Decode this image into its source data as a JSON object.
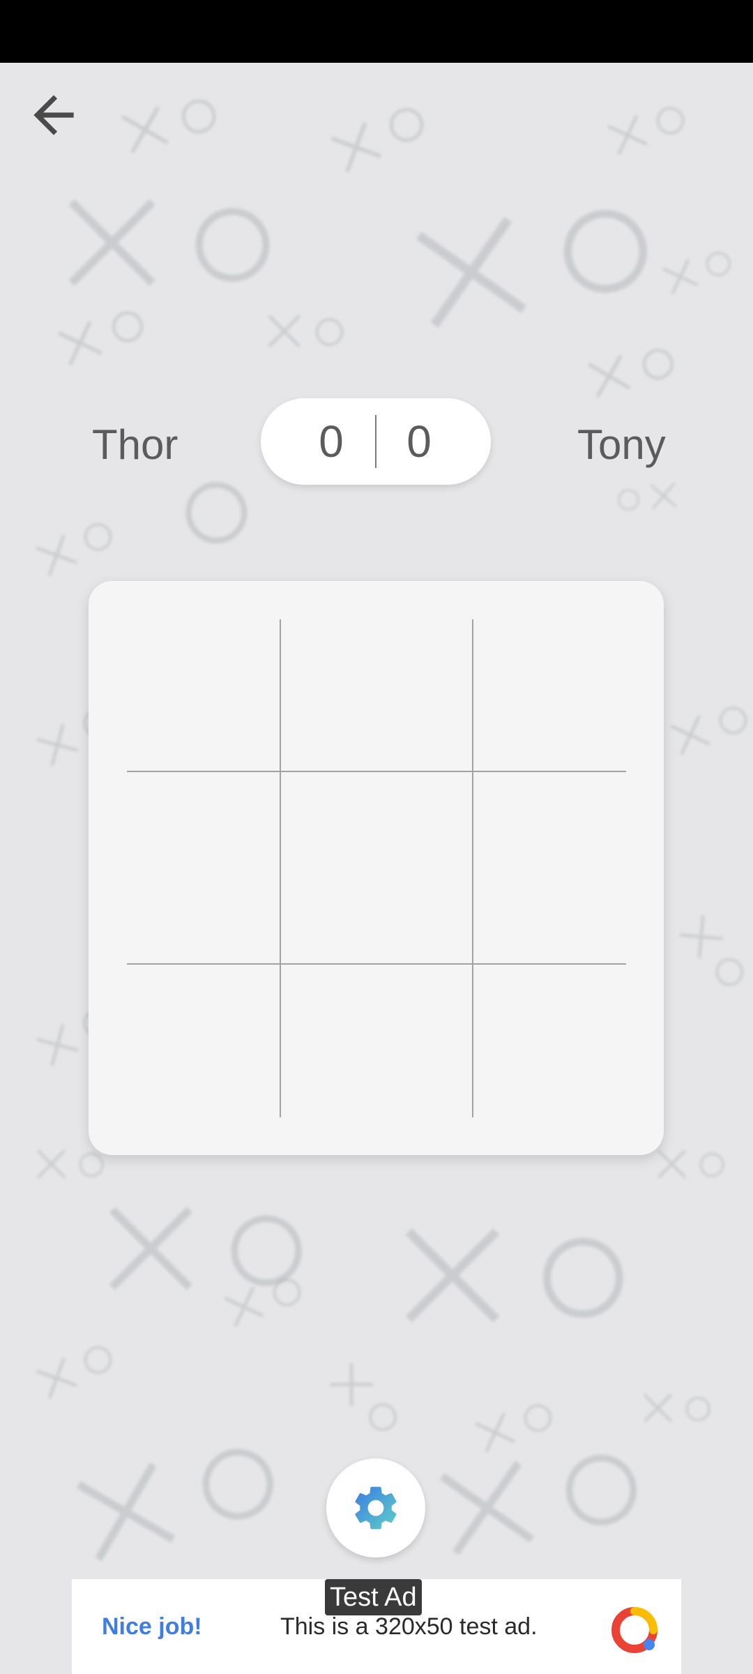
{
  "players": {
    "left_name": "Thor",
    "right_name": "Tony",
    "left_score": "0",
    "right_score": "0"
  },
  "board": {
    "cells": [
      "",
      "",
      "",
      "",
      "",
      "",
      "",
      "",
      ""
    ]
  },
  "ad": {
    "tag": "Test Ad",
    "cta": "Nice job!",
    "text": "This is a 320x50 test ad."
  },
  "icons": {
    "back": "arrow-left-icon",
    "settings": "gear-icon",
    "ad_logo": "google-ads-logo-icon"
  },
  "colors": {
    "background": "#e6e6e8",
    "board": "#f4f5f4",
    "grid_line": "#a2a2a2",
    "text": "#5b5b5b",
    "gear_gradient_start": "#3b7be0",
    "gear_gradient_end": "#5fd0c8",
    "ad_cta": "#3f7de0"
  }
}
